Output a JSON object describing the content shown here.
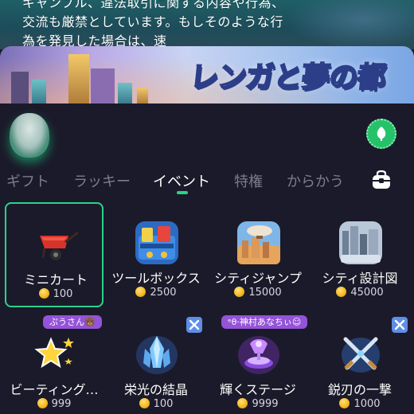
{
  "chat": {
    "message": "ギャンブル、違法取引に関する内容や行為、交流も厳禁としています。もしそのような行為を発見した場合は、速"
  },
  "banner": {
    "title": "レンガと夢の都"
  },
  "tabs": [
    {
      "label": "ギフト",
      "active": false
    },
    {
      "label": "ラッキー",
      "active": false
    },
    {
      "label": "イベント",
      "active": true
    },
    {
      "label": "特権",
      "active": false
    },
    {
      "label": "からかう",
      "active": false
    }
  ],
  "icons": {
    "voice": "microphone-icon",
    "bag": "backpack-icon",
    "coin": "coin-icon",
    "close": "close-x-icon"
  },
  "colors": {
    "accent": "#2ad38a",
    "panel_bg": "#1b1a2a",
    "tag_bg": "#9453d8",
    "x_btn_bg": "#5e8ee6"
  },
  "gifts_row1": [
    {
      "name": "ミニカート",
      "price": "100",
      "selected": true,
      "icon": "wheelbarrow-icon"
    },
    {
      "name": "ツールボックス",
      "price": "2500",
      "selected": false,
      "icon": "toolbox-icon"
    },
    {
      "name": "シティジャンプ",
      "price": "15000",
      "selected": false,
      "icon": "airship-city-icon"
    },
    {
      "name": "シティ設計図",
      "price": "45000",
      "selected": false,
      "icon": "city-blueprint-icon"
    }
  ],
  "gifts_row2": [
    {
      "name": "ビーティング…",
      "price": "999",
      "tag": "ぷうさん🐻",
      "icon": "stars-icon"
    },
    {
      "name": "栄光の結晶",
      "price": "100",
      "tag": "",
      "icon": "crystal-icon"
    },
    {
      "name": "輝くステージ",
      "price": "9999",
      "tag": "ᵉθ·神村あなちぃ☺",
      "icon": "stage-icon"
    },
    {
      "name": "鋭刃の一撃",
      "price": "1000",
      "tag": "",
      "icon": "crossed-swords-icon"
    }
  ]
}
